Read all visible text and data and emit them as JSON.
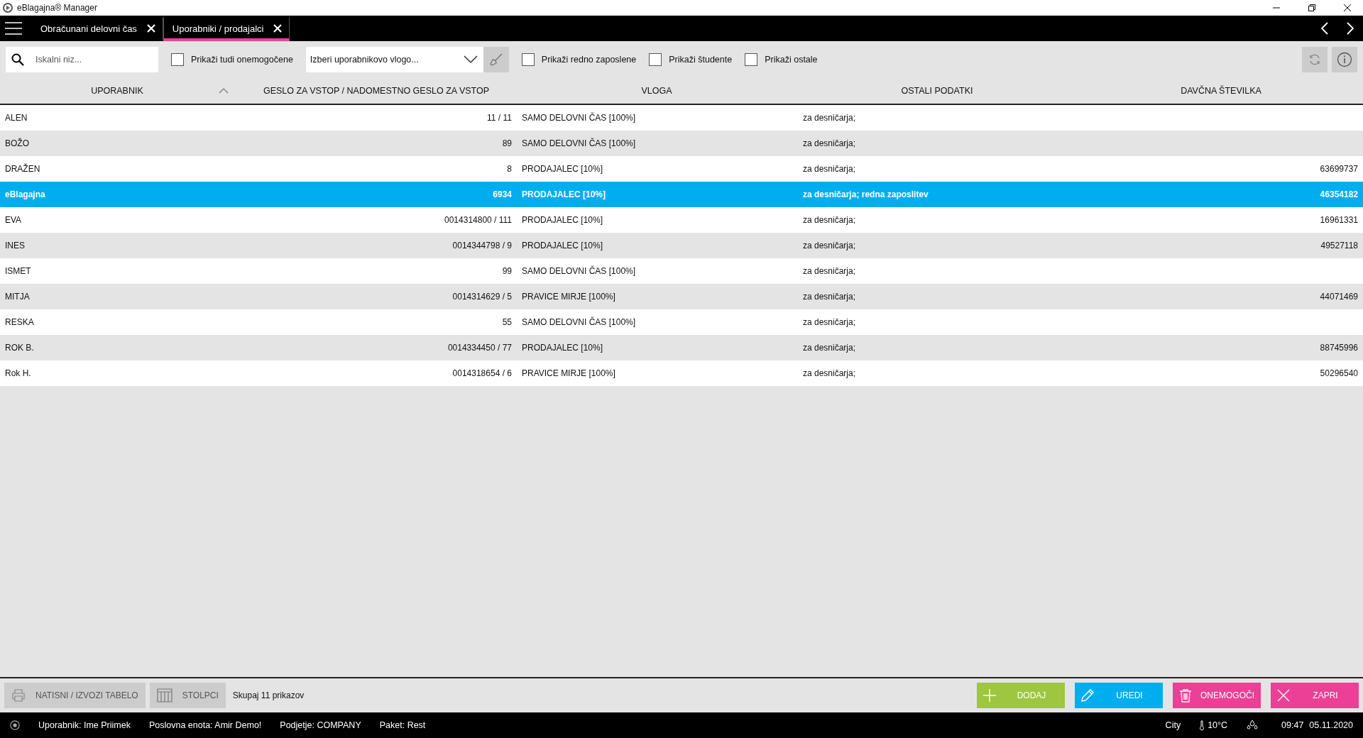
{
  "window": {
    "title": "eBlagajna® Manager"
  },
  "tabs": [
    {
      "label": "Obračunani delovni čas",
      "selected": false
    },
    {
      "label": "Uporabniki / prodajalci",
      "selected": true
    }
  ],
  "toolbar": {
    "search": {
      "placeholder": "Iskalni niz..."
    },
    "filters": [
      {
        "label": "Prikaži tudi onemogočene",
        "checked": false
      }
    ],
    "role_select": {
      "placeholder": "Izberi uporabnikovo vlogo..."
    },
    "filters_2": [
      {
        "label": "Prikaži redno zaposlene",
        "checked": false
      },
      {
        "label": "Prikaži študente",
        "checked": false
      },
      {
        "label": "Prikaži ostale",
        "checked": false
      }
    ]
  },
  "table": {
    "columns": [
      {
        "label": "UPORABNIK",
        "sorted": true
      },
      {
        "label": "GESLO ZA VSTOP / NADOMESTNO GESLO ZA VSTOP",
        "sorted": false
      },
      {
        "label": "VLOGA",
        "sorted": false
      },
      {
        "label": "OSTALI PODATKI",
        "sorted": false
      },
      {
        "label": "DAVČNA ŠTEVILKA",
        "sorted": false
      }
    ],
    "rows": [
      {
        "user": "ALEN",
        "password": "11 / 11",
        "role": "SAMO DELOVNI ČAS [100%]",
        "other": "za desničarja;",
        "tax": "",
        "selected": false
      },
      {
        "user": "BOŽO",
        "password": "89",
        "role": "SAMO DELOVNI ČAS [100%]",
        "other": "za desničarja;",
        "tax": "",
        "selected": false
      },
      {
        "user": "DRAŽEN",
        "password": "8",
        "role": "PRODAJALEC [10%]",
        "other": "za desničarja;",
        "tax": "63699737",
        "selected": false
      },
      {
        "user": "eBlagajna",
        "password": "6934",
        "role": "PRODAJALEC [10%]",
        "other": "za desničarja; redna zaposlitev",
        "tax": "46354182",
        "selected": true
      },
      {
        "user": "EVA",
        "password": "0014314800 / 111",
        "role": "PRODAJALEC [10%]",
        "other": "za desničarja;",
        "tax": "16961331",
        "selected": false
      },
      {
        "user": "INES",
        "password": "0014344798 / 9",
        "role": "PRODAJALEC [10%]",
        "other": "za desničarja;",
        "tax": "49527118",
        "selected": false
      },
      {
        "user": "ISMET",
        "password": "99",
        "role": "SAMO DELOVNI ČAS [100%]",
        "other": "za desničarja;",
        "tax": "",
        "selected": false
      },
      {
        "user": "MITJA",
        "password": "0014314629 / 5",
        "role": "PRAVICE MIRJE [100%]",
        "other": "za desničarja;",
        "tax": "44071469",
        "selected": false
      },
      {
        "user": "RESKA",
        "password": "55",
        "role": "SAMO DELOVNI ČAS [100%]",
        "other": "za desničarja;",
        "tax": "",
        "selected": false
      },
      {
        "user": "ROK B.",
        "password": "0014334450 / 77",
        "role": "PRODAJALEC [10%]",
        "other": "za desničarja;",
        "tax": "88745996",
        "selected": false
      },
      {
        "user": "Rok H.",
        "password": "0014318654 / 6",
        "role": "PRAVICE MIRJE [100%]",
        "other": "za desničarja;",
        "tax": "50296540",
        "selected": false
      }
    ]
  },
  "bottom_bar": {
    "tools": [
      {
        "label": "NATISNI / IZVOZI TABELO",
        "kind": "print"
      },
      {
        "label": "STOLPCI",
        "kind": "columns"
      }
    ],
    "count": "Skupaj 11 prikazov",
    "actions": [
      {
        "label": "DODAJ",
        "kind": "add",
        "color": "#9ec641"
      },
      {
        "label": "UREDI",
        "kind": "edit",
        "color": "#00aeef"
      },
      {
        "label": "ONEMOGOČI",
        "kind": "disable",
        "color": "#ec3f96"
      },
      {
        "label": "ZAPRI",
        "kind": "close",
        "color": "#ec3f96"
      }
    ]
  },
  "status_bar": {
    "items": [
      "Uporabnik: Ime Priimek",
      "Poslovna enota: Amir Demo!",
      "Podjetje: COMPANY",
      "Paket: Rest"
    ],
    "city": "City",
    "temperature": "10°C",
    "time": "09:47",
    "date": "05.11.2020"
  }
}
